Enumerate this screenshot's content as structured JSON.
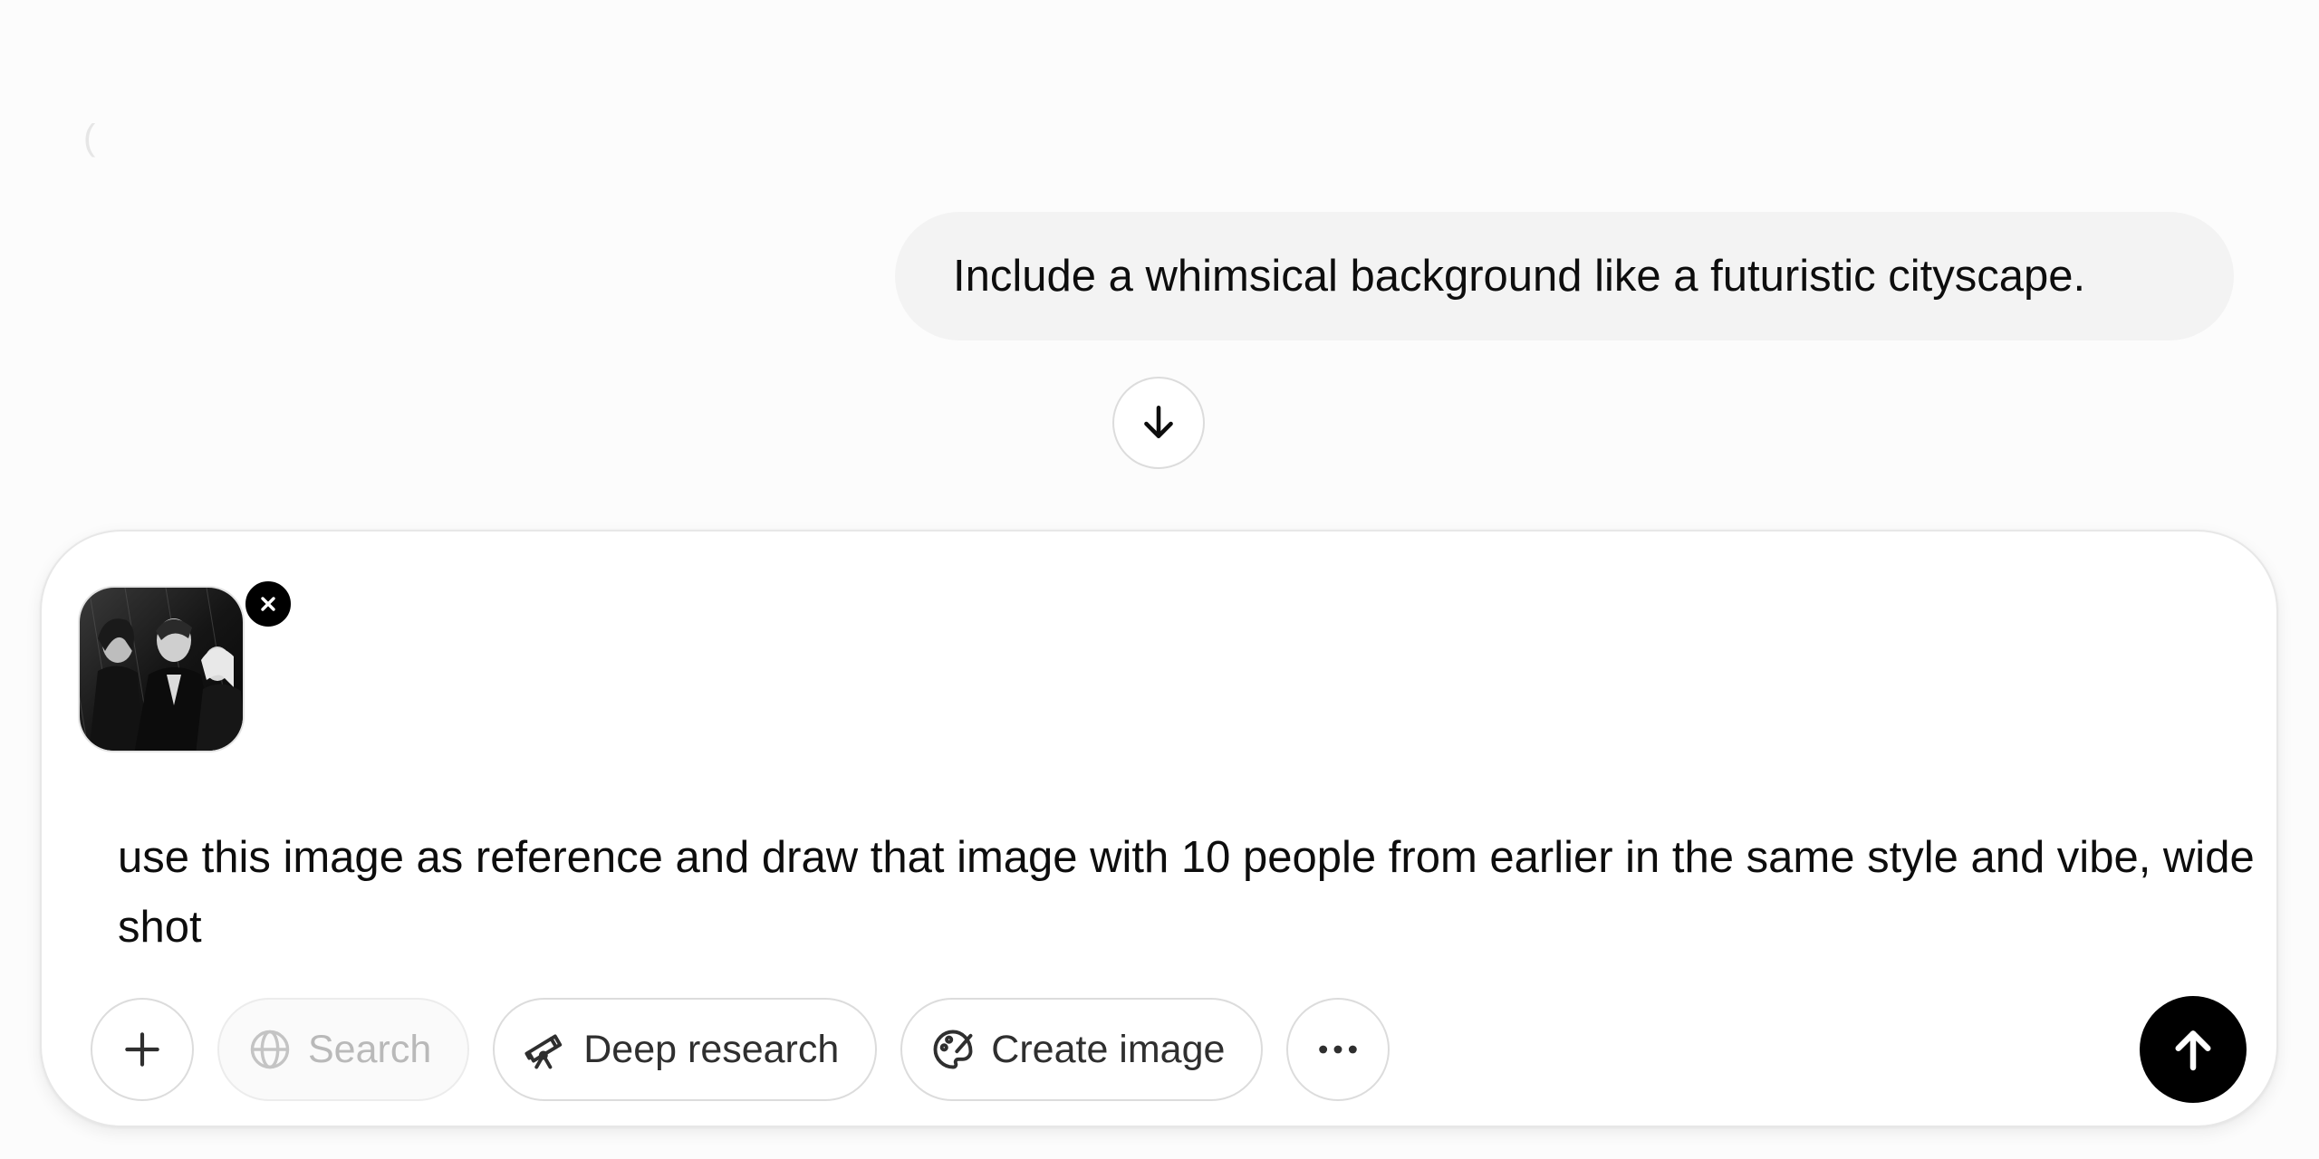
{
  "conversation": {
    "stray_glyph": "(",
    "user_message": "Include a whimsical background like a futuristic cityscape."
  },
  "scroll_button": {
    "icon": "arrow-down-icon"
  },
  "composer": {
    "attachment": {
      "icon": "image-thumbnail",
      "remove_icon": "close-icon"
    },
    "prompt_text": "use this image as reference and draw that image with 10 people from earlier in the same style and vibe, wide shot",
    "toolbar": {
      "add_icon": "plus-icon",
      "search_label": "Search",
      "search_icon": "globe-icon",
      "deep_research_label": "Deep research",
      "deep_research_icon": "telescope-icon",
      "create_image_label": "Create image",
      "create_image_icon": "palette-icon",
      "more_icon": "ellipsis-icon"
    },
    "send_icon": "arrow-up-icon"
  },
  "colors": {
    "background": "#fcfcfc",
    "bubble": "#f3f3f3",
    "send_button": "#000000",
    "text": "#0d0d0d"
  }
}
